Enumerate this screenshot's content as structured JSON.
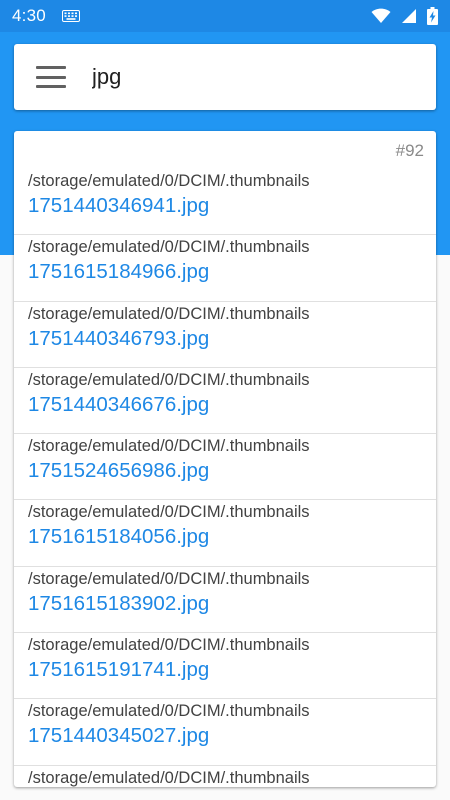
{
  "status_bar": {
    "time": "4:30",
    "icons": [
      "keyboard-icon",
      "wifi-icon",
      "signal-icon",
      "battery-charging-icon"
    ]
  },
  "search": {
    "query": "jpg",
    "menu_icon": "hamburger-menu-icon"
  },
  "results": {
    "count_label": "#92",
    "items": [
      {
        "path": "/storage/emulated/0/DCIM/.thumbnails",
        "name": "1751440346941.jpg"
      },
      {
        "path": "/storage/emulated/0/DCIM/.thumbnails",
        "name": "1751615184966.jpg"
      },
      {
        "path": "/storage/emulated/0/DCIM/.thumbnails",
        "name": "1751440346793.jpg"
      },
      {
        "path": "/storage/emulated/0/DCIM/.thumbnails",
        "name": "1751440346676.jpg"
      },
      {
        "path": "/storage/emulated/0/DCIM/.thumbnails",
        "name": "1751524656986.jpg"
      },
      {
        "path": "/storage/emulated/0/DCIM/.thumbnails",
        "name": "1751615184056.jpg"
      },
      {
        "path": "/storage/emulated/0/DCIM/.thumbnails",
        "name": "1751615183902.jpg"
      },
      {
        "path": "/storage/emulated/0/DCIM/.thumbnails",
        "name": "1751615191741.jpg"
      },
      {
        "path": "/storage/emulated/0/DCIM/.thumbnails",
        "name": "1751440345027.jpg"
      },
      {
        "path": "/storage/emulated/0/DCIM/.thumbnails",
        "name": ""
      }
    ]
  },
  "colors": {
    "primary": "#2196f3",
    "status_bar": "#1e88e5",
    "link": "#1e88e5",
    "path_text": "#424242",
    "count_text": "#8a8a8a",
    "divider": "#e0e0e0"
  }
}
